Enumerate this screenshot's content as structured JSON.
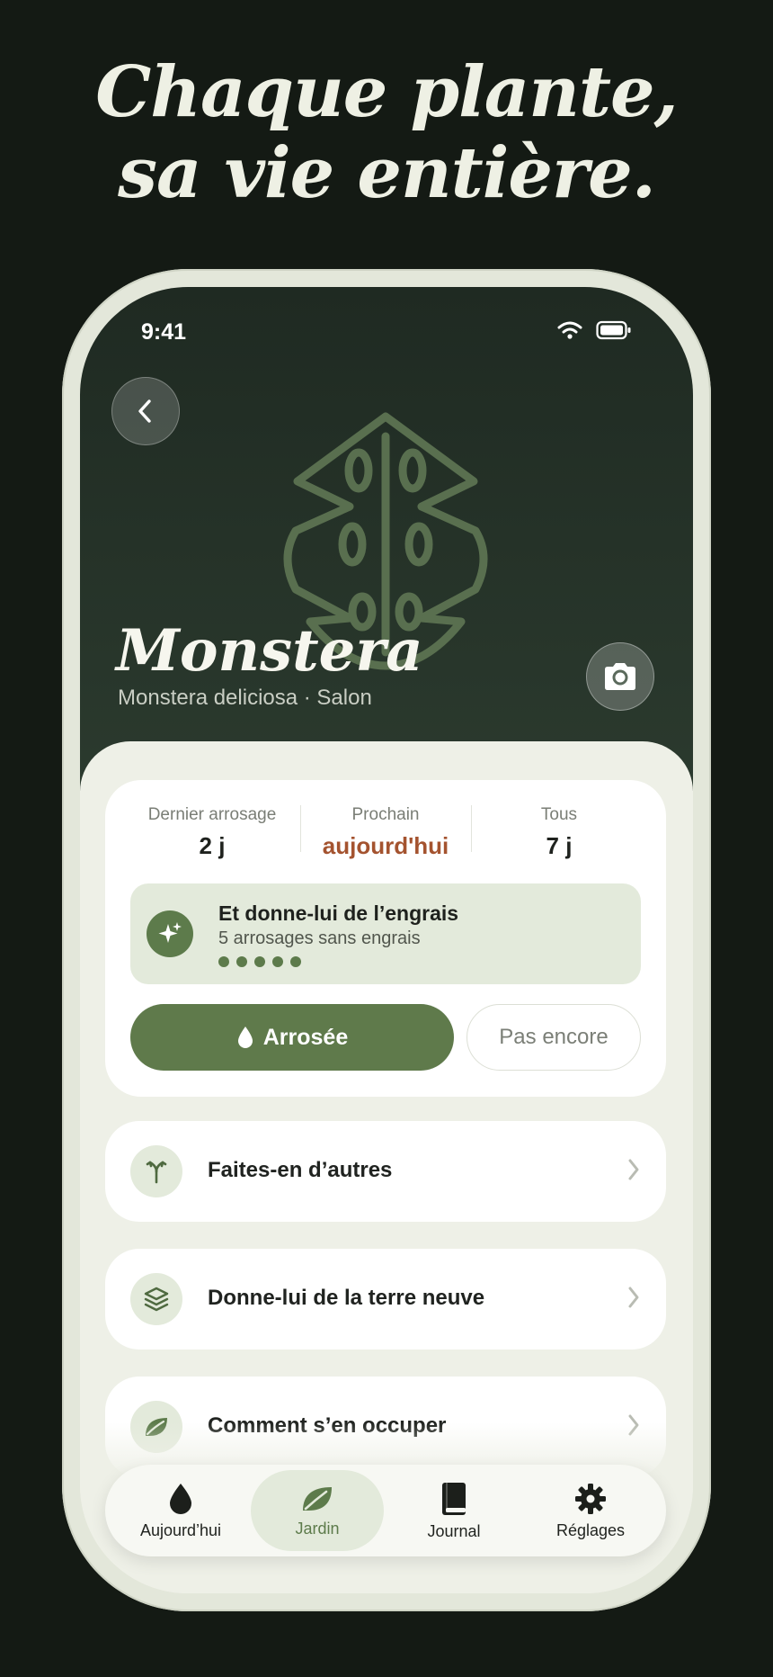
{
  "headline": {
    "line1": "Chaque plante,",
    "line2": "sa vie entière."
  },
  "status": {
    "time": "9:41"
  },
  "plant": {
    "name": "Monstera",
    "subtitle": "Monstera deliciosa · Salon"
  },
  "stats": [
    {
      "label": "Dernier arrosage",
      "value": "2 j"
    },
    {
      "label": "Prochain",
      "value": "aujourd'hui"
    },
    {
      "label": "Tous",
      "value": "7 j"
    }
  ],
  "reminder": {
    "title": "Et donne-lui de l’engrais",
    "subtitle": "5 arrosages sans engrais",
    "dots": 5
  },
  "actions": {
    "primary": "Arrosée",
    "secondary": "Pas encore"
  },
  "rows": [
    {
      "label": "Faites-en d’autres",
      "icon": "propagate-icon"
    },
    {
      "label": "Donne-lui de la terre neuve",
      "icon": "layers-icon"
    },
    {
      "label": "Comment s’en occuper",
      "icon": "leaf-icon"
    }
  ],
  "tabs": [
    {
      "label": "Aujourd’hui",
      "icon": "drop-icon"
    },
    {
      "label": "Jardin",
      "icon": "leaf-icon",
      "active": true
    },
    {
      "label": "Journal",
      "icon": "book-icon"
    },
    {
      "label": "Réglages",
      "icon": "gear-icon"
    }
  ],
  "colors": {
    "background": "#141a14",
    "accent_green": "#5f7a4b",
    "accent_orange": "#a4532f",
    "hero_dark": "#1f2a22",
    "sheet": "#eef0e7"
  }
}
